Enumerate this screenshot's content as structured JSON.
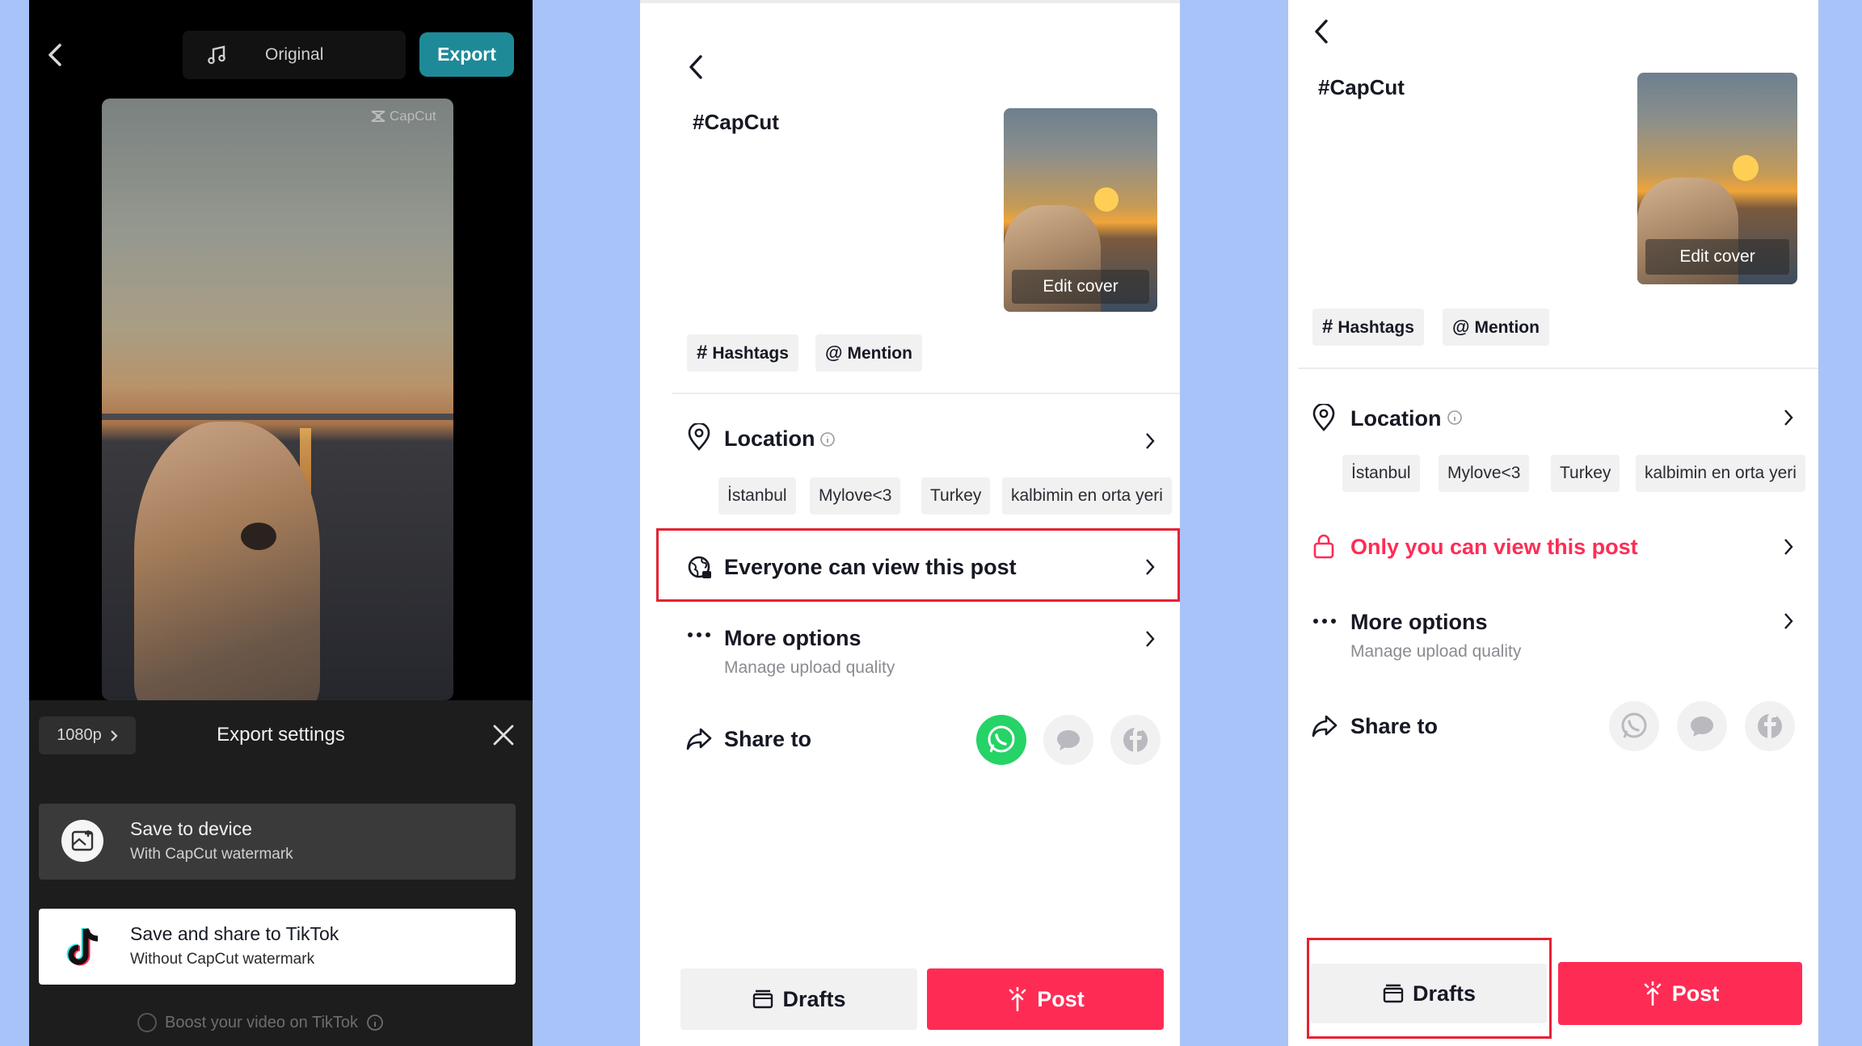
{
  "panel1": {
    "original_label": "Original",
    "export_label": "Export",
    "watermark": "CapCut",
    "resolution": "1080p",
    "sheet_title": "Export settings",
    "options": [
      {
        "title": "Save to device",
        "subtitle": "With CapCut watermark"
      },
      {
        "title": "Save and share to TikTok",
        "subtitle": "Without CapCut watermark"
      }
    ],
    "boost_label": "Boost your video on TikTok"
  },
  "panel2": {
    "caption": "#CapCut",
    "edit_cover": "Edit cover",
    "hashtags_label": "Hashtags",
    "mention_label": "Mention",
    "location_label": "Location",
    "location_chips": [
      "İstanbul",
      "Mylove<3",
      "Turkey",
      "kalbimin en orta yeri"
    ],
    "privacy_label": "Everyone can view this post",
    "more_options_label": "More options",
    "more_options_sub": "Manage upload quality",
    "share_label": "Share to",
    "drafts_label": "Drafts",
    "post_label": "Post"
  },
  "panel3": {
    "caption": "#CapCut",
    "edit_cover": "Edit cover",
    "hashtags_label": "Hashtags",
    "mention_label": "Mention",
    "location_label": "Location",
    "location_chips": [
      "İstanbul",
      "Mylove<3",
      "Turkey",
      "kalbimin en orta yeri"
    ],
    "privacy_label": "Only you can view this post",
    "more_options_label": "More options",
    "more_options_sub": "Manage upload quality",
    "share_label": "Share to",
    "drafts_label": "Drafts",
    "post_label": "Post"
  },
  "colors": {
    "accent_red": "#fe2c55",
    "highlight_red": "#e52233",
    "capcut_teal": "#1e8a98",
    "whatsapp_green": "#25d366",
    "background_blue": "#a8c3f7"
  }
}
